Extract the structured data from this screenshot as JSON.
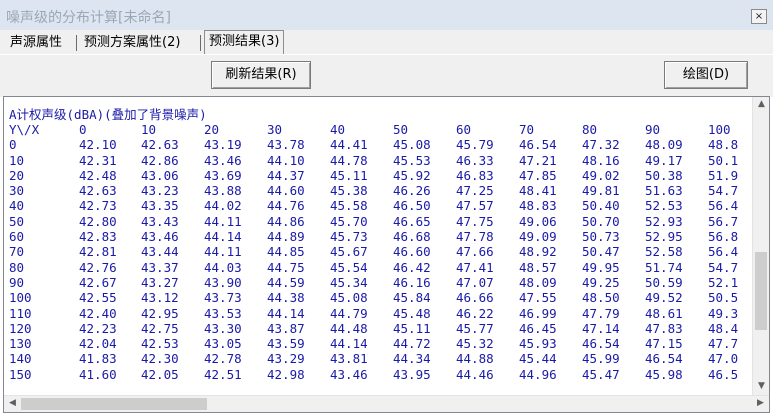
{
  "window": {
    "title": "噪声级的分布计算[未命名]",
    "close_label": "×"
  },
  "tabs": [
    {
      "label": "声源属性"
    },
    {
      "label": "预测方案属性(2)"
    },
    {
      "label": "预测结果(3)"
    }
  ],
  "toolbar": {
    "refresh_label": "刷新结果(R)",
    "plot_label": "绘图(D)"
  },
  "results": {
    "heading": "A计权声级(dBA)(叠加了背景噪声)",
    "corner_label": "Y\\/X",
    "x_headers": [
      "0",
      "10",
      "20",
      "30",
      "40",
      "50",
      "60",
      "70",
      "80",
      "90",
      "100"
    ],
    "rows": [
      {
        "y": "0",
        "values": [
          "42.10",
          "42.63",
          "43.19",
          "43.78",
          "44.41",
          "45.08",
          "45.79",
          "46.54",
          "47.32",
          "48.09",
          "48.8"
        ]
      },
      {
        "y": "10",
        "values": [
          "42.31",
          "42.86",
          "43.46",
          "44.10",
          "44.78",
          "45.53",
          "46.33",
          "47.21",
          "48.16",
          "49.17",
          "50.1"
        ]
      },
      {
        "y": "20",
        "values": [
          "42.48",
          "43.06",
          "43.69",
          "44.37",
          "45.11",
          "45.92",
          "46.83",
          "47.85",
          "49.02",
          "50.38",
          "51.9"
        ]
      },
      {
        "y": "30",
        "values": [
          "42.63",
          "43.23",
          "43.88",
          "44.60",
          "45.38",
          "46.26",
          "47.25",
          "48.41",
          "49.81",
          "51.63",
          "54.7"
        ]
      },
      {
        "y": "40",
        "values": [
          "42.73",
          "43.35",
          "44.02",
          "44.76",
          "45.58",
          "46.50",
          "47.57",
          "48.83",
          "50.40",
          "52.53",
          "56.4"
        ]
      },
      {
        "y": "50",
        "values": [
          "42.80",
          "43.43",
          "44.11",
          "44.86",
          "45.70",
          "46.65",
          "47.75",
          "49.06",
          "50.70",
          "52.93",
          "56.7"
        ]
      },
      {
        "y": "60",
        "values": [
          "42.83",
          "43.46",
          "44.14",
          "44.89",
          "45.73",
          "46.68",
          "47.78",
          "49.09",
          "50.73",
          "52.95",
          "56.8"
        ]
      },
      {
        "y": "70",
        "values": [
          "42.81",
          "43.44",
          "44.11",
          "44.85",
          "45.67",
          "46.60",
          "47.66",
          "48.92",
          "50.47",
          "52.58",
          "56.4"
        ]
      },
      {
        "y": "80",
        "values": [
          "42.76",
          "43.37",
          "44.03",
          "44.75",
          "45.54",
          "46.42",
          "47.41",
          "48.57",
          "49.95",
          "51.74",
          "54.7"
        ]
      },
      {
        "y": "90",
        "values": [
          "42.67",
          "43.27",
          "43.90",
          "44.59",
          "45.34",
          "46.16",
          "47.07",
          "48.09",
          "49.25",
          "50.59",
          "52.1"
        ]
      },
      {
        "y": "100",
        "values": [
          "42.55",
          "43.12",
          "43.73",
          "44.38",
          "45.08",
          "45.84",
          "46.66",
          "47.55",
          "48.50",
          "49.52",
          "50.5"
        ]
      },
      {
        "y": "110",
        "values": [
          "42.40",
          "42.95",
          "43.53",
          "44.14",
          "44.79",
          "45.48",
          "46.22",
          "46.99",
          "47.79",
          "48.61",
          "49.3"
        ]
      },
      {
        "y": "120",
        "values": [
          "42.23",
          "42.75",
          "43.30",
          "43.87",
          "44.48",
          "45.11",
          "45.77",
          "46.45",
          "47.14",
          "47.83",
          "48.4"
        ]
      },
      {
        "y": "130",
        "values": [
          "42.04",
          "42.53",
          "43.05",
          "43.59",
          "44.14",
          "44.72",
          "45.32",
          "45.93",
          "46.54",
          "47.15",
          "47.7"
        ]
      },
      {
        "y": "140",
        "values": [
          "41.83",
          "42.30",
          "42.78",
          "43.29",
          "43.81",
          "44.34",
          "44.88",
          "45.44",
          "45.99",
          "46.54",
          "47.0"
        ]
      },
      {
        "y": "150",
        "values": [
          "41.60",
          "42.05",
          "42.51",
          "42.98",
          "43.46",
          "43.95",
          "44.46",
          "44.96",
          "45.47",
          "45.98",
          "46.5"
        ]
      }
    ]
  },
  "icons": {
    "scroll_up": "▲",
    "scroll_down": "▼",
    "scroll_left": "◀",
    "scroll_right": "▶"
  }
}
